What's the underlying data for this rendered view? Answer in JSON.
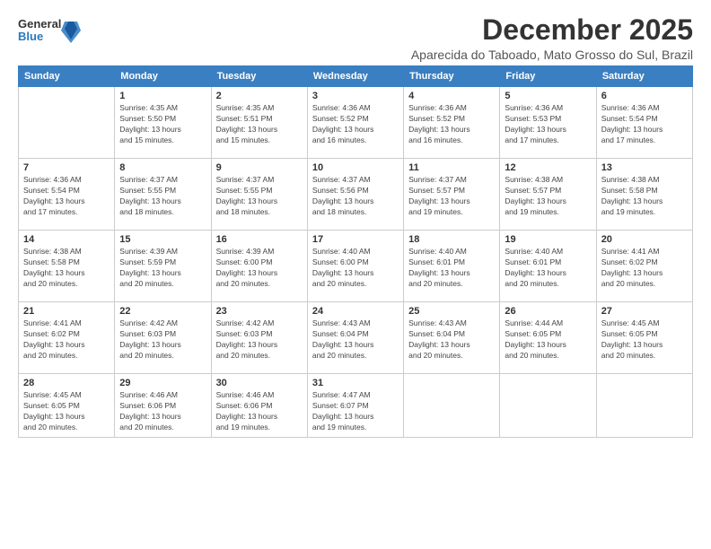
{
  "logo": {
    "general": "General",
    "blue": "Blue"
  },
  "title": "December 2025",
  "location": "Aparecida do Taboado, Mato Grosso do Sul, Brazil",
  "days_of_week": [
    "Sunday",
    "Monday",
    "Tuesday",
    "Wednesday",
    "Thursday",
    "Friday",
    "Saturday"
  ],
  "weeks": [
    [
      {
        "day": "",
        "info": ""
      },
      {
        "day": "1",
        "info": "Sunrise: 4:35 AM\nSunset: 5:50 PM\nDaylight: 13 hours\nand 15 minutes."
      },
      {
        "day": "2",
        "info": "Sunrise: 4:35 AM\nSunset: 5:51 PM\nDaylight: 13 hours\nand 15 minutes."
      },
      {
        "day": "3",
        "info": "Sunrise: 4:36 AM\nSunset: 5:52 PM\nDaylight: 13 hours\nand 16 minutes."
      },
      {
        "day": "4",
        "info": "Sunrise: 4:36 AM\nSunset: 5:52 PM\nDaylight: 13 hours\nand 16 minutes."
      },
      {
        "day": "5",
        "info": "Sunrise: 4:36 AM\nSunset: 5:53 PM\nDaylight: 13 hours\nand 17 minutes."
      },
      {
        "day": "6",
        "info": "Sunrise: 4:36 AM\nSunset: 5:54 PM\nDaylight: 13 hours\nand 17 minutes."
      }
    ],
    [
      {
        "day": "7",
        "info": "Sunrise: 4:36 AM\nSunset: 5:54 PM\nDaylight: 13 hours\nand 17 minutes."
      },
      {
        "day": "8",
        "info": "Sunrise: 4:37 AM\nSunset: 5:55 PM\nDaylight: 13 hours\nand 18 minutes."
      },
      {
        "day": "9",
        "info": "Sunrise: 4:37 AM\nSunset: 5:55 PM\nDaylight: 13 hours\nand 18 minutes."
      },
      {
        "day": "10",
        "info": "Sunrise: 4:37 AM\nSunset: 5:56 PM\nDaylight: 13 hours\nand 18 minutes."
      },
      {
        "day": "11",
        "info": "Sunrise: 4:37 AM\nSunset: 5:57 PM\nDaylight: 13 hours\nand 19 minutes."
      },
      {
        "day": "12",
        "info": "Sunrise: 4:38 AM\nSunset: 5:57 PM\nDaylight: 13 hours\nand 19 minutes."
      },
      {
        "day": "13",
        "info": "Sunrise: 4:38 AM\nSunset: 5:58 PM\nDaylight: 13 hours\nand 19 minutes."
      }
    ],
    [
      {
        "day": "14",
        "info": "Sunrise: 4:38 AM\nSunset: 5:58 PM\nDaylight: 13 hours\nand 20 minutes."
      },
      {
        "day": "15",
        "info": "Sunrise: 4:39 AM\nSunset: 5:59 PM\nDaylight: 13 hours\nand 20 minutes."
      },
      {
        "day": "16",
        "info": "Sunrise: 4:39 AM\nSunset: 6:00 PM\nDaylight: 13 hours\nand 20 minutes."
      },
      {
        "day": "17",
        "info": "Sunrise: 4:40 AM\nSunset: 6:00 PM\nDaylight: 13 hours\nand 20 minutes."
      },
      {
        "day": "18",
        "info": "Sunrise: 4:40 AM\nSunset: 6:01 PM\nDaylight: 13 hours\nand 20 minutes."
      },
      {
        "day": "19",
        "info": "Sunrise: 4:40 AM\nSunset: 6:01 PM\nDaylight: 13 hours\nand 20 minutes."
      },
      {
        "day": "20",
        "info": "Sunrise: 4:41 AM\nSunset: 6:02 PM\nDaylight: 13 hours\nand 20 minutes."
      }
    ],
    [
      {
        "day": "21",
        "info": "Sunrise: 4:41 AM\nSunset: 6:02 PM\nDaylight: 13 hours\nand 20 minutes."
      },
      {
        "day": "22",
        "info": "Sunrise: 4:42 AM\nSunset: 6:03 PM\nDaylight: 13 hours\nand 20 minutes."
      },
      {
        "day": "23",
        "info": "Sunrise: 4:42 AM\nSunset: 6:03 PM\nDaylight: 13 hours\nand 20 minutes."
      },
      {
        "day": "24",
        "info": "Sunrise: 4:43 AM\nSunset: 6:04 PM\nDaylight: 13 hours\nand 20 minutes."
      },
      {
        "day": "25",
        "info": "Sunrise: 4:43 AM\nSunset: 6:04 PM\nDaylight: 13 hours\nand 20 minutes."
      },
      {
        "day": "26",
        "info": "Sunrise: 4:44 AM\nSunset: 6:05 PM\nDaylight: 13 hours\nand 20 minutes."
      },
      {
        "day": "27",
        "info": "Sunrise: 4:45 AM\nSunset: 6:05 PM\nDaylight: 13 hours\nand 20 minutes."
      }
    ],
    [
      {
        "day": "28",
        "info": "Sunrise: 4:45 AM\nSunset: 6:05 PM\nDaylight: 13 hours\nand 20 minutes."
      },
      {
        "day": "29",
        "info": "Sunrise: 4:46 AM\nSunset: 6:06 PM\nDaylight: 13 hours\nand 20 minutes."
      },
      {
        "day": "30",
        "info": "Sunrise: 4:46 AM\nSunset: 6:06 PM\nDaylight: 13 hours\nand 19 minutes."
      },
      {
        "day": "31",
        "info": "Sunrise: 4:47 AM\nSunset: 6:07 PM\nDaylight: 13 hours\nand 19 minutes."
      },
      {
        "day": "",
        "info": ""
      },
      {
        "day": "",
        "info": ""
      },
      {
        "day": "",
        "info": ""
      }
    ]
  ]
}
